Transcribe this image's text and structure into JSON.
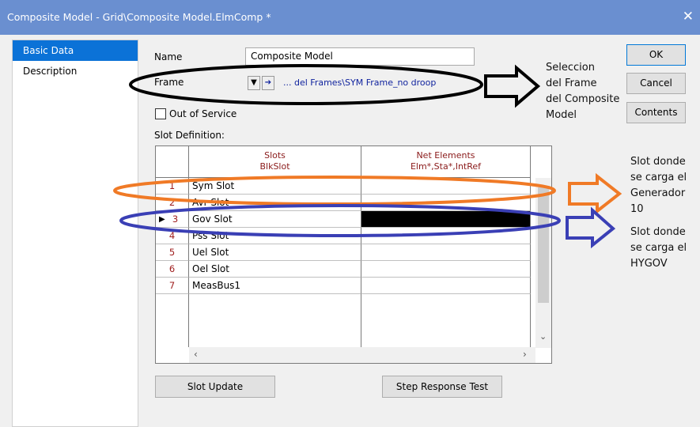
{
  "window": {
    "title": "Composite Model - Grid\\Composite Model.ElmComp *",
    "close_glyph": "✕"
  },
  "nav": {
    "items": [
      {
        "label": "Basic Data"
      },
      {
        "label": "Description"
      }
    ]
  },
  "form": {
    "name_label": "Name",
    "name_value": "Composite Model",
    "frame_label": "Frame",
    "frame_value": "... del Frames\\SYM Frame_no droop",
    "out_of_service_label": "Out of Service",
    "out_of_service_checked": false,
    "slot_definition_label": "Slot Definition:"
  },
  "grid": {
    "columns": [
      {
        "line1": "Slots",
        "line2": "BlkSlot"
      },
      {
        "line1": "Net Elements",
        "line2": "Elm*,Sta*,IntRef"
      }
    ],
    "selected_row": 3,
    "rows": [
      {
        "num": "1",
        "slot": "Sym Slot"
      },
      {
        "num": "2",
        "slot": "Avr Slot"
      },
      {
        "num": "3",
        "slot": "Gov Slot"
      },
      {
        "num": "4",
        "slot": "Pss Slot"
      },
      {
        "num": "5",
        "slot": "Uel Slot"
      },
      {
        "num": "6",
        "slot": "Oel Slot"
      },
      {
        "num": "7",
        "slot": "MeasBus1"
      }
    ]
  },
  "buttons": {
    "ok": "OK",
    "cancel": "Cancel",
    "contents": "Contents",
    "slot_update": "Slot Update",
    "step_response": "Step Response Test"
  },
  "annotations": {
    "frame_note": [
      "Seleccion",
      "del Frame",
      "del Composite",
      "Model"
    ],
    "gen_note": [
      "Slot donde",
      "se carga el",
      "Generador",
      "10"
    ],
    "gov_note": [
      "Slot donde",
      "se carga el",
      "HYGOV"
    ]
  },
  "colors": {
    "title_bar": "#6a8fd0",
    "nav_active": "#0b72d7",
    "black_ellipse": "#000000",
    "orange_annotation": "#f07a26",
    "blue_annotation": "#3a3fb5"
  },
  "icons": {
    "close": "close-icon",
    "dropdown": "triangle-down-icon",
    "jump": "arrow-right-icon",
    "row_pointer": "row-pointer-icon"
  }
}
